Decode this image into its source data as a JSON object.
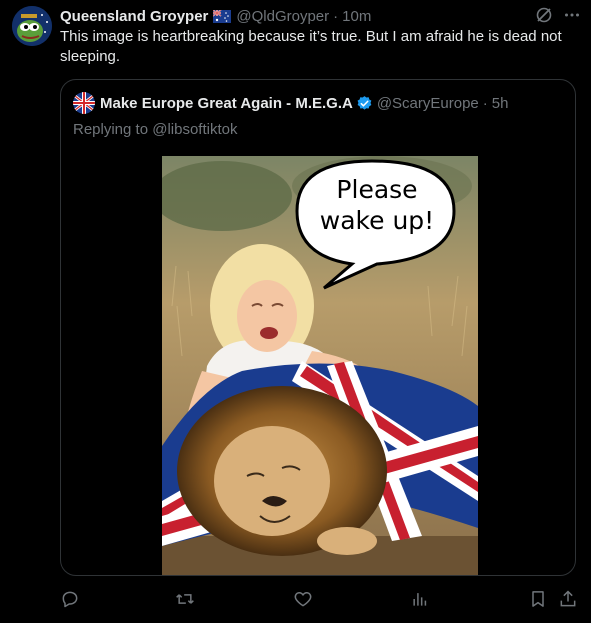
{
  "author": {
    "name": "Queensland Groyper",
    "handle": "@QldGroyper",
    "time": "10m",
    "flag_icon": "australia-flag-icon"
  },
  "tweet": {
    "text": "This image is heartbreaking because it’s true. But I am afraid he is dead not sleeping."
  },
  "quote": {
    "name": "Make Europe Great Again - M.E.G.A",
    "handle": "@ScaryEurope",
    "time": "5h",
    "reply_prefix": "Replying to ",
    "reply_mention": "@libsoftiktok",
    "image_speech": [
      "Please",
      "wake up!"
    ]
  },
  "actions": [
    "reply-icon",
    "retweet-icon",
    "like-icon",
    "views-icon",
    "bookmark-icon",
    "share-icon"
  ],
  "colors": {
    "background": "#000000",
    "text": "#e7e9ea",
    "muted": "#71767b",
    "border": "#2f3336",
    "verified": "#1d9bf0"
  }
}
